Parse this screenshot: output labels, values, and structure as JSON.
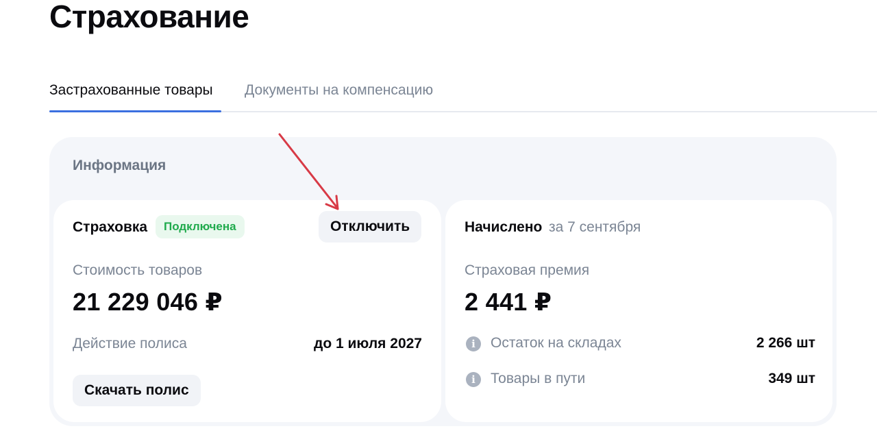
{
  "page": {
    "title": "Страхование"
  },
  "tabs": [
    {
      "label": "Застрахованные товары",
      "active": true
    },
    {
      "label": "Документы на компенсацию",
      "active": false
    }
  ],
  "info": {
    "title": "Информация",
    "insurance_card": {
      "label": "Страховка",
      "status_badge": "Подключена",
      "disable_button": "Отключить",
      "goods_cost_label": "Стоимость товаров",
      "goods_cost_value": "21 229 046 ₽",
      "policy_label": "Действие полиса",
      "policy_value": "до 1 июля 2027",
      "download_button": "Скачать полис"
    },
    "accrued_card": {
      "label": "Начислено",
      "date": "за 7 сентября",
      "premium_label": "Страховая премия",
      "premium_value": "2 441 ₽",
      "stats": [
        {
          "label": "Остаток на складах",
          "value": "2 266 шт",
          "icon": "info-icon"
        },
        {
          "label": "Товары в пути",
          "value": "349 шт",
          "icon": "info-icon"
        }
      ]
    }
  },
  "colors": {
    "accent": "#3b6fe0",
    "badge_bg": "#e9f8ee",
    "badge_text": "#1faa4c",
    "arrow": "#d83a46",
    "panel_bg": "#f4f6fa",
    "muted_text": "#7b8594"
  }
}
